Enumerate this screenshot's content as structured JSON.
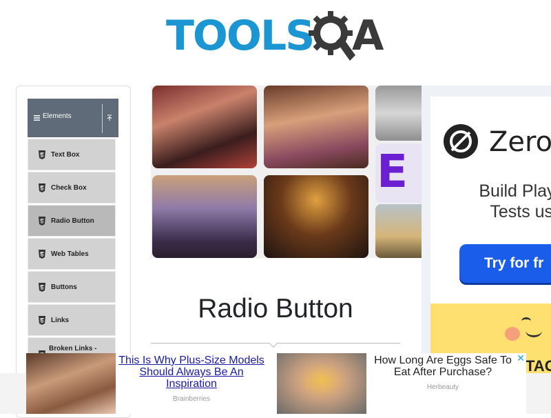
{
  "header": {
    "logo_text": "TOOLS",
    "logo_text_end": "A"
  },
  "sidebar": {
    "group": {
      "label": "Elements",
      "menu_icon": "hamburger-icon",
      "toggle_icon": "collapse-up-icon"
    },
    "items": [
      {
        "label": "Text Box",
        "icon": "html5-icon"
      },
      {
        "label": "Check Box",
        "icon": "html5-icon"
      },
      {
        "label": "Radio Button",
        "icon": "html5-icon",
        "active": true
      },
      {
        "label": "Web Tables",
        "icon": "html5-icon"
      },
      {
        "label": "Buttons",
        "icon": "html5-icon"
      },
      {
        "label": "Links",
        "icon": "html5-icon"
      },
      {
        "label": "Broken Links -",
        "icon": "html5-icon"
      }
    ]
  },
  "ad_grid": {
    "partial_letter": "E"
  },
  "side_ad": {
    "brand": "Zero",
    "headline_line1": "Build Playw",
    "headline_line2": "Tests usi",
    "cta": "Try for fr",
    "tag": "TAG"
  },
  "main": {
    "title": "Radio Button"
  },
  "bottom_ad": {
    "left": {
      "headline": "This Is Why Plus-Size Models Should Always Be An Inspiration",
      "source": "Brainberries"
    },
    "right": {
      "headline": "How Long Are Eggs Safe To Eat After Purchase?",
      "source": "Herbeauty"
    },
    "close_glyph": "✕"
  },
  "colors": {
    "logo_blue": "#1b96d3",
    "logo_dark": "#3a3a3a",
    "sidebar_header": "#5f6b78",
    "menu_item": "#d2d2d2",
    "menu_item_active": "#b9b9b9",
    "cta_blue": "#1a5dea",
    "link_blue": "#1a1aa6"
  }
}
